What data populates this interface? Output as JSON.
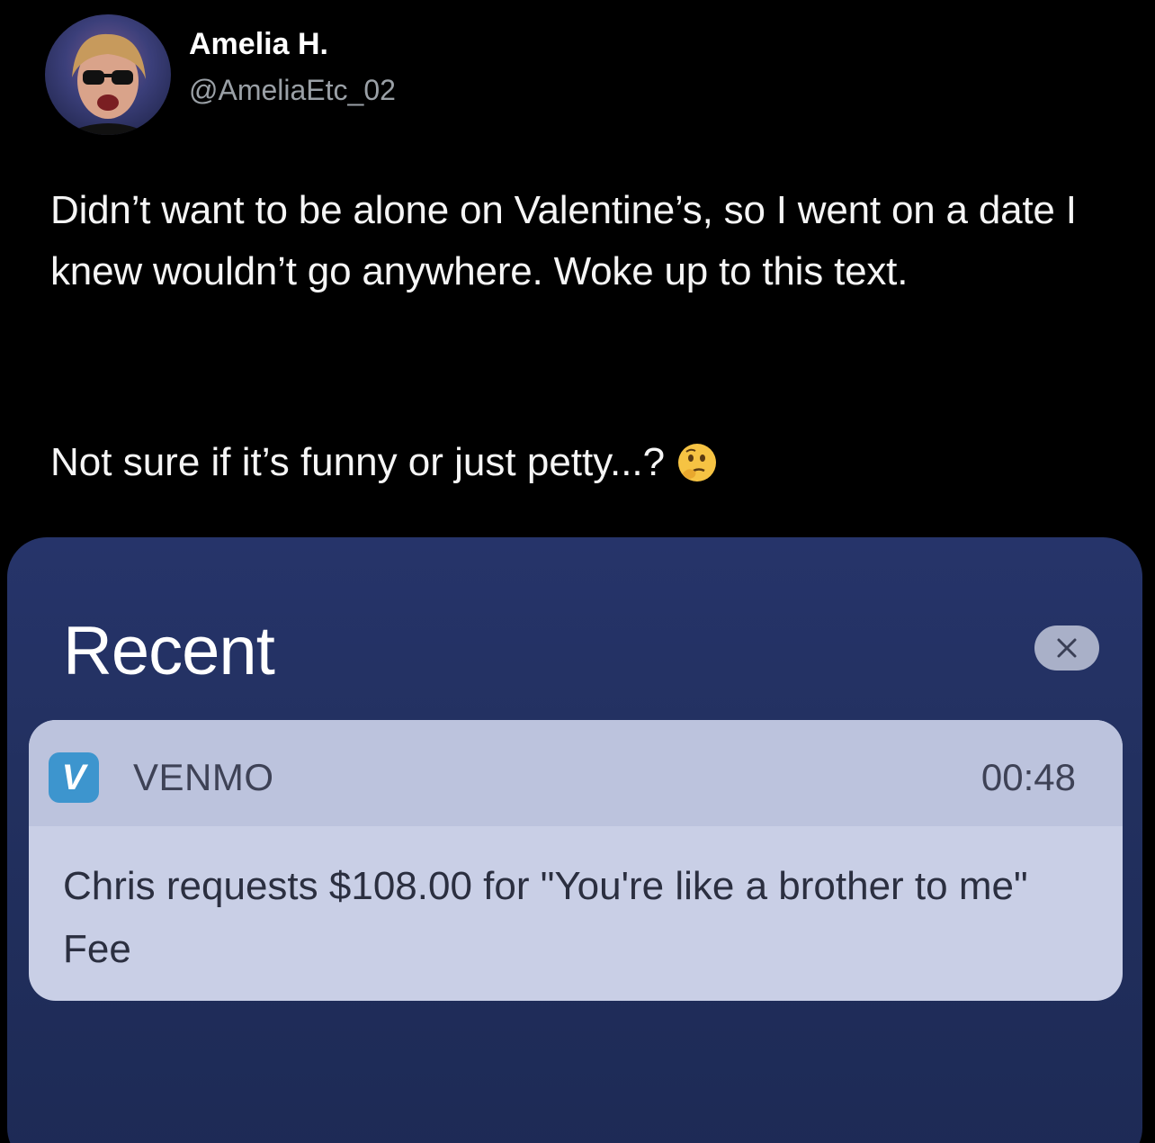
{
  "tweet": {
    "author_name": "Amelia H.",
    "author_handle": "@AmeliaEtc_02",
    "text_paragraph_1": "Didn’t want to be alone on Valentine’s, so I went on a date I knew wouldn’t go anywhere. Woke up to this text.",
    "text_paragraph_2": "Not sure if it’s funny or just petty...?",
    "emoji": "thinking-face-icon"
  },
  "notification_center": {
    "title": "Recent",
    "close_icon": "close-icon",
    "notification": {
      "app_icon": "venmo-icon",
      "app_icon_letter": "V",
      "app_name": "VENMO",
      "time": "00:48",
      "message": "Chris requests $108.00 for \"You're like a brother to me\" Fee"
    }
  },
  "colors": {
    "background": "#000000",
    "panel": "#22305f",
    "card": "#c9cfe6",
    "venmo_blue": "#3d95ce"
  }
}
